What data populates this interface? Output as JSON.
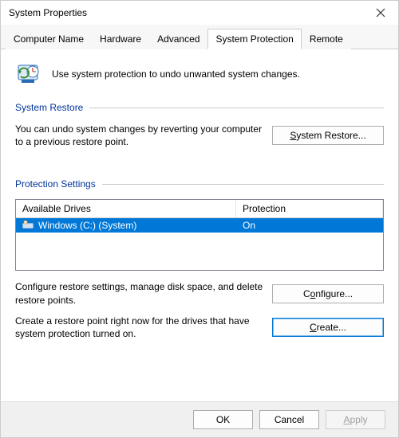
{
  "title": "System Properties",
  "tabs": {
    "computer_name": "Computer Name",
    "hardware": "Hardware",
    "advanced": "Advanced",
    "system_protection": "System Protection",
    "remote": "Remote"
  },
  "intro_text": "Use system protection to undo unwanted system changes.",
  "system_restore": {
    "heading": "System Restore",
    "text": "You can undo system changes by reverting your computer to a previous restore point.",
    "button": "System Restore..."
  },
  "protection_settings": {
    "heading": "Protection Settings",
    "header_drive": "Available Drives",
    "header_protection": "Protection",
    "drive_name": "Windows (C:) (System)",
    "drive_protection": "On",
    "configure_text": "Configure restore settings, manage disk space, and delete restore points.",
    "configure_button": "Configure...",
    "create_text": "Create a restore point right now for the drives that have system protection turned on.",
    "create_button": "Create..."
  },
  "footer": {
    "ok": "OK",
    "cancel": "Cancel",
    "apply": "Apply"
  }
}
